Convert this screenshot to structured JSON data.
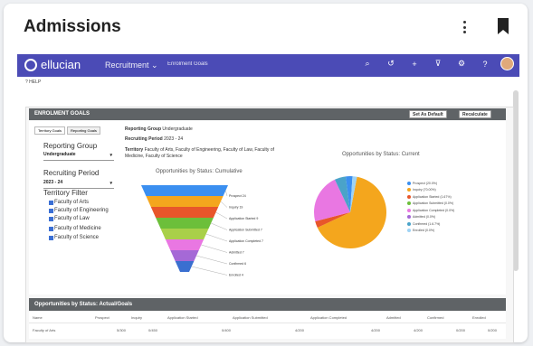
{
  "card": {
    "title": "Admissions"
  },
  "appbar": {
    "logo": "ellucian",
    "nav": "Recruitment",
    "subnav": "Enrolment Goals"
  },
  "help": "HELP",
  "goals": {
    "header": "ENROLMENT GOALS",
    "set_default": "Set As Default",
    "recalculate": "Recalculate",
    "tabs": [
      "Territory Goals",
      "Reporting Goals"
    ],
    "reporting_group_label": "Reporting Group",
    "reporting_group_value": "Undergraduate",
    "recruiting_period_label": "Recruiting Period",
    "recruiting_period_value": "2023 - 24",
    "territory_filter_label": "Territory Filter",
    "faculties": [
      "Faculty of Arts",
      "Faculty of Engineering",
      "Faculty of Law",
      "Faculty of Medicine",
      "Faculty of Science"
    ],
    "info": {
      "rg_key": "Reporting Group",
      "rg_val": "Undergraduate",
      "rp_key": "Recruiting Period",
      "rp_val": "2023 - 24",
      "ter_key": "Territory",
      "ter_val": "Faculty of Arts, Faculty of Engineering, Faculty of Law, Faculty of Medicine, Faculty of Science"
    }
  },
  "chart_data": [
    {
      "type": "funnel",
      "title": "Opportunities by Status: Cumulative",
      "categories": [
        "Prospect",
        "Inquiry",
        "Application Started",
        "Application Submitted",
        "Application Completed",
        "Admitted",
        "Confirmed",
        "Enrolled"
      ],
      "values": [
        24,
        19,
        9,
        7,
        7,
        7,
        6,
        4
      ],
      "labels": [
        "Prospect 24",
        "Inquiry 19",
        "Application Started 9",
        "Application Submitted 7",
        "Application Completed 7",
        "Admitted 7",
        "Confirmed 6",
        "Enrolled 4"
      ],
      "colors": [
        "#3b8ff0",
        "#f4a61d",
        "#e8562a",
        "#6cbf3a",
        "#a9d049",
        "#e977e2",
        "#a569d6",
        "#3a6fd0"
      ]
    },
    {
      "type": "pie",
      "title": "Opportunities by Status: Current",
      "categories": [
        "Prospect",
        "Inquiry",
        "Application Started",
        "Application Submitted",
        "Application Completed",
        "Admitted",
        "Confirmed",
        "Enrolled"
      ],
      "legend": [
        "Prospect (20.0%)",
        "Inquiry (70.00%)",
        "Application Started (1.67%)",
        "Application Submitted (0.0%)",
        "Application Completed (0.0%)",
        "Admitted (0.0%)",
        "Confirmed (1.6.7%)",
        "Enrolled (0.0%)"
      ],
      "values": [
        3,
        65,
        3,
        0,
        22,
        0,
        5,
        2
      ],
      "colors": [
        "#3b8ff0",
        "#f4a61d",
        "#e8562a",
        "#6cbf3a",
        "#e977e2",
        "#a569d6",
        "#4aa3c9",
        "#9fd3f5"
      ]
    }
  ],
  "bottom": {
    "header": "Opportunities by Status: Actual/Goals",
    "columns": [
      "Name",
      "Prospect",
      "Inquiry",
      "Application Started",
      "Application Submitted",
      "Application Completed",
      "Admitted",
      "Confirmed",
      "Enrolled"
    ],
    "row": [
      "Faculty of Arts",
      "5/300",
      "0/450",
      "0/400",
      "4/200",
      "4/200",
      "4/200",
      "0/200",
      "0/200"
    ]
  }
}
